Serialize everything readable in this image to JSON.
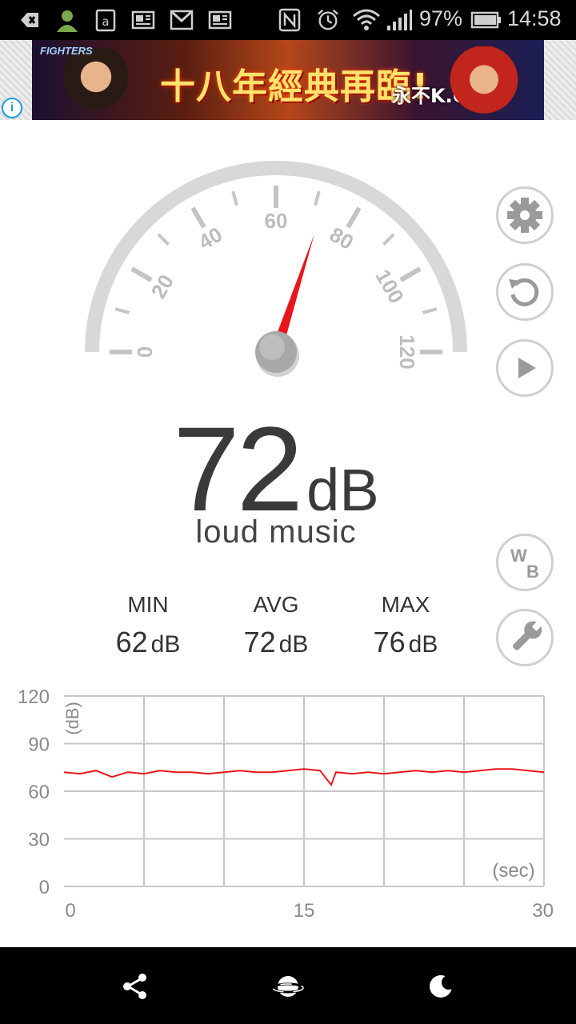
{
  "status_bar": {
    "battery_percent": "97%",
    "time": "14:58",
    "icons": [
      "back-arrow-icon",
      "contact-icon",
      "amazon-icon",
      "news-icon",
      "gmail-icon",
      "news-icon",
      "nfc-icon",
      "alarm-icon",
      "wifi-icon",
      "signal-icon",
      "battery-icon"
    ]
  },
  "ad": {
    "headline": "十八年經典再臨!",
    "tagline": "永不K.O.",
    "logo": "FIGHTERS",
    "info_icon": "info-icon"
  },
  "gauge": {
    "min": 0,
    "max": 120,
    "tick_labels": [
      "0",
      "20",
      "40",
      "60",
      "80",
      "100",
      "120"
    ],
    "needle_value": 72,
    "needle_color": "#e8161c"
  },
  "readout": {
    "value": "72",
    "unit": "dB",
    "description": "loud music"
  },
  "side_buttons": {
    "settings_icon": "gear-icon",
    "reset_icon": "refresh-icon",
    "play_icon": "play-icon",
    "wb_top": "W",
    "wb_bottom": "B",
    "tools_icon": "wrench-icon"
  },
  "stats": {
    "min_label": "MIN",
    "min_value": "62",
    "avg_label": "AVG",
    "avg_value": "72",
    "max_label": "MAX",
    "max_value": "76",
    "unit": "dB"
  },
  "chart_data": {
    "type": "line",
    "title": "",
    "ylabel": "(dB)",
    "xlabel": "(sec)",
    "x_ticks": [
      "0",
      "15",
      "30"
    ],
    "y_ticks": [
      "120",
      "90",
      "60",
      "30",
      "0"
    ],
    "xlim": [
      0,
      30
    ],
    "ylim": [
      0,
      120
    ],
    "grid": true,
    "line_color": "#e8161c",
    "series": [
      {
        "x": [
          0,
          1,
          2,
          3,
          4,
          5,
          6,
          7,
          8,
          9,
          10,
          11,
          12,
          13,
          14,
          15,
          16,
          16.7,
          17,
          18,
          19,
          20,
          21,
          22,
          23,
          24,
          25,
          26,
          27,
          28,
          29,
          30
        ],
        "values": [
          72,
          71,
          73,
          69,
          72,
          71,
          73,
          72,
          72,
          71,
          72,
          73,
          72,
          72,
          73,
          74,
          73,
          64,
          72,
          71,
          72,
          71,
          72,
          73,
          72,
          73,
          72,
          73,
          74,
          74,
          73,
          72
        ]
      }
    ]
  },
  "nav_bar": {
    "icons": [
      "share-icon",
      "planet-icon",
      "moon-icon"
    ]
  }
}
